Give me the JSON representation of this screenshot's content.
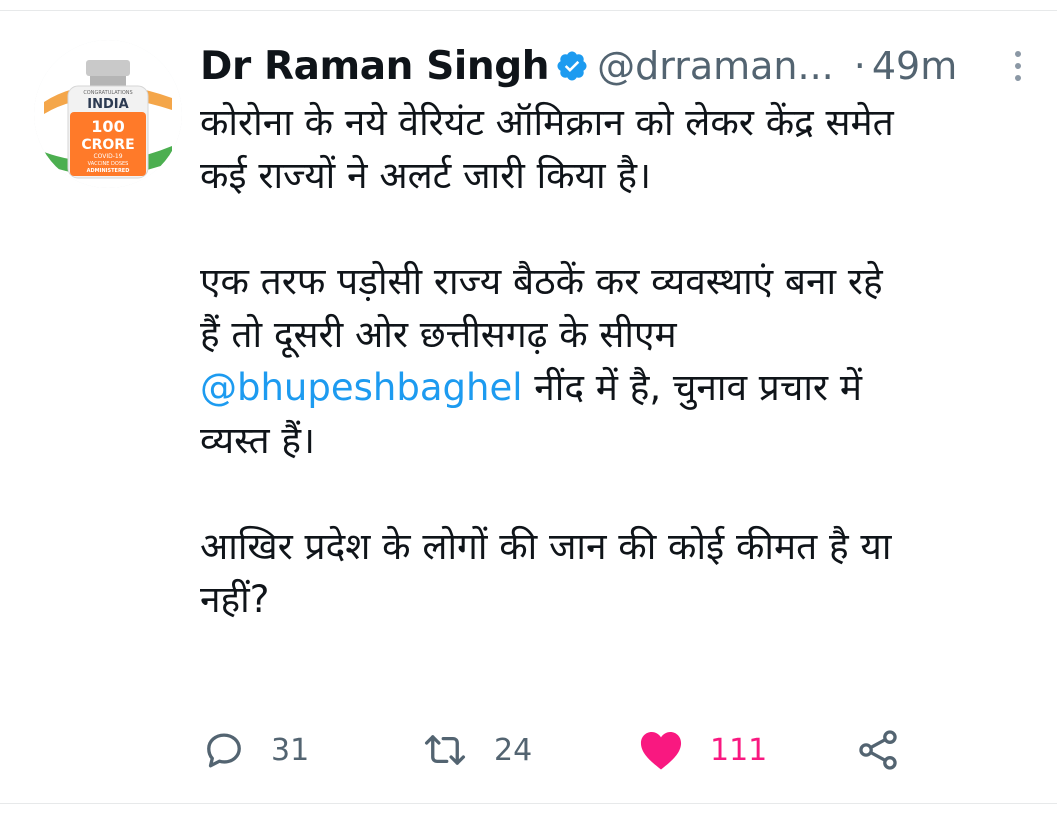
{
  "tweet": {
    "avatar": {
      "icon": "vaccine-bottle-avatar",
      "badge_text": [
        "CONGRATULATIONS",
        "INDIA",
        "100",
        "CRORE",
        "COVID-19",
        "VACCINE DOSES",
        "ADMINISTERED"
      ]
    },
    "author_name": "Dr Raman Singh",
    "handle": "@drraman...",
    "separator": "·",
    "time": "49m",
    "text_lines": {
      "l1": "कोरोना के नये वेरियंट ऑमिक्रान को लेकर केंद्र समेत",
      "l2": "कई राज्यों ने अलर्ट जारी किया है।",
      "l3": "एक तरफ पड़ोसी राज्य बैठकें कर व्यवस्थाएं बना रहे",
      "l4": "हैं तो दूसरी ओर छत्तीसगढ़ के सीएम",
      "l5_mention": "@bhupeshbaghel",
      "l5_rest": " नींद में है, चुनाव प्रचार में",
      "l6": "व्यस्त हैं।",
      "l7": "आखिर प्रदेश के लोगों की जान की कोई कीमत है या",
      "l8": "नहीं?"
    },
    "actions": {
      "reply_count": "31",
      "retweet_count": "24",
      "like_count": "111"
    },
    "colors": {
      "accent": "#1d9bf0",
      "like": "#f91880",
      "secondary_text": "#536471"
    }
  }
}
